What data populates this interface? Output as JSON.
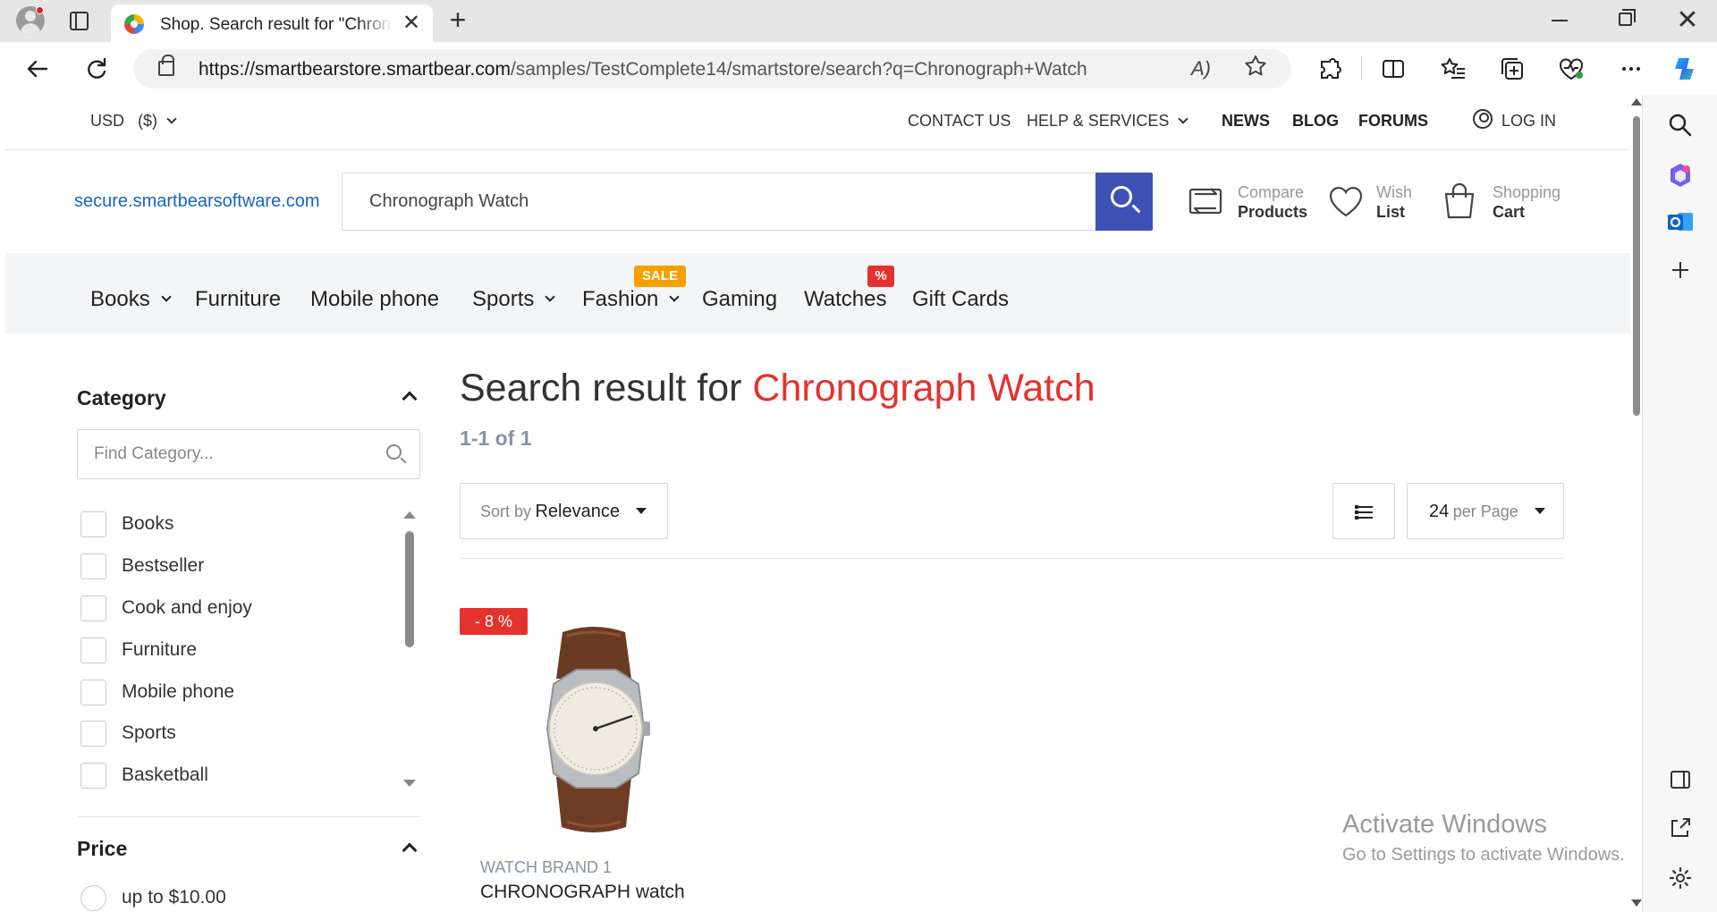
{
  "browser": {
    "tab_title": "Shop. Search result for \"Chronograph Watch\"",
    "tab_close": "✕",
    "new_tab": "+",
    "address_url_host": "https://smartbearstore.smartbear.com",
    "address_url_path": "/samples/TestComplete14/smartstore/search?q=Chronograph+Watch",
    "read_aloud": "A)",
    "window_close": "✕",
    "toolbar_icons": [
      "back-icon",
      "refresh-icon",
      "extensions-icon",
      "split-screen-icon",
      "favorites-icon",
      "collections-icon",
      "browser-essentials-icon",
      "more-icon",
      "copilot-icon"
    ],
    "sidebar_icons": [
      "search-icon",
      "copilot-apps-icon",
      "outlook-icon",
      "add-icon",
      "sidebar-toggle-icon",
      "open-external-icon",
      "settings-icon"
    ]
  },
  "utility": {
    "currency": "USD",
    "currency_symbol": "($)",
    "contact": "CONTACT US",
    "help": "HELP & SERVICES",
    "news": "NEWS",
    "blog": "BLOG",
    "forums": "FORUMS",
    "login": "LOG IN"
  },
  "header": {
    "site_link": "secure.smartbearsoftware.com",
    "search_value": "Chronograph Watch",
    "compare_l1": "Compare",
    "compare_l2": "Products",
    "wish_l1": "Wish",
    "wish_l2": "List",
    "cart_l1": "Shopping",
    "cart_l2": "Cart"
  },
  "nav": {
    "items": [
      "Books",
      "Furniture",
      "Mobile phone",
      "Sports",
      "Fashion",
      "Gaming",
      "Watches",
      "Gift Cards"
    ],
    "badge_sale": "SALE",
    "badge_pct": "%"
  },
  "filters": {
    "category_title": "Category",
    "category_placeholder": "Find Category...",
    "categories": [
      "Books",
      "Bestseller",
      "Cook and enjoy",
      "Furniture",
      "Mobile phone",
      "Sports",
      "Basketball"
    ],
    "price_title": "Price",
    "price_first": "up to $10.00"
  },
  "results": {
    "title_prefix": "Search result for",
    "title_term": "Chronograph Watch",
    "count": "1-1 of 1",
    "sort_prefix": "Sort by",
    "sort_value": "Relevance",
    "per_page_value": "24",
    "per_page_suffix": "per Page"
  },
  "product": {
    "discount": "- 8 %",
    "brand": "WATCH BRAND 1",
    "name": "CHRONOGRAPH watch"
  },
  "os": {
    "activate_title": "Activate Windows",
    "activate_sub": "Go to Settings to activate Windows."
  },
  "colors": {
    "accent": "#3f51b5",
    "link": "#1565c0",
    "highlight": "#e5322d",
    "sale": "#f5a000"
  }
}
